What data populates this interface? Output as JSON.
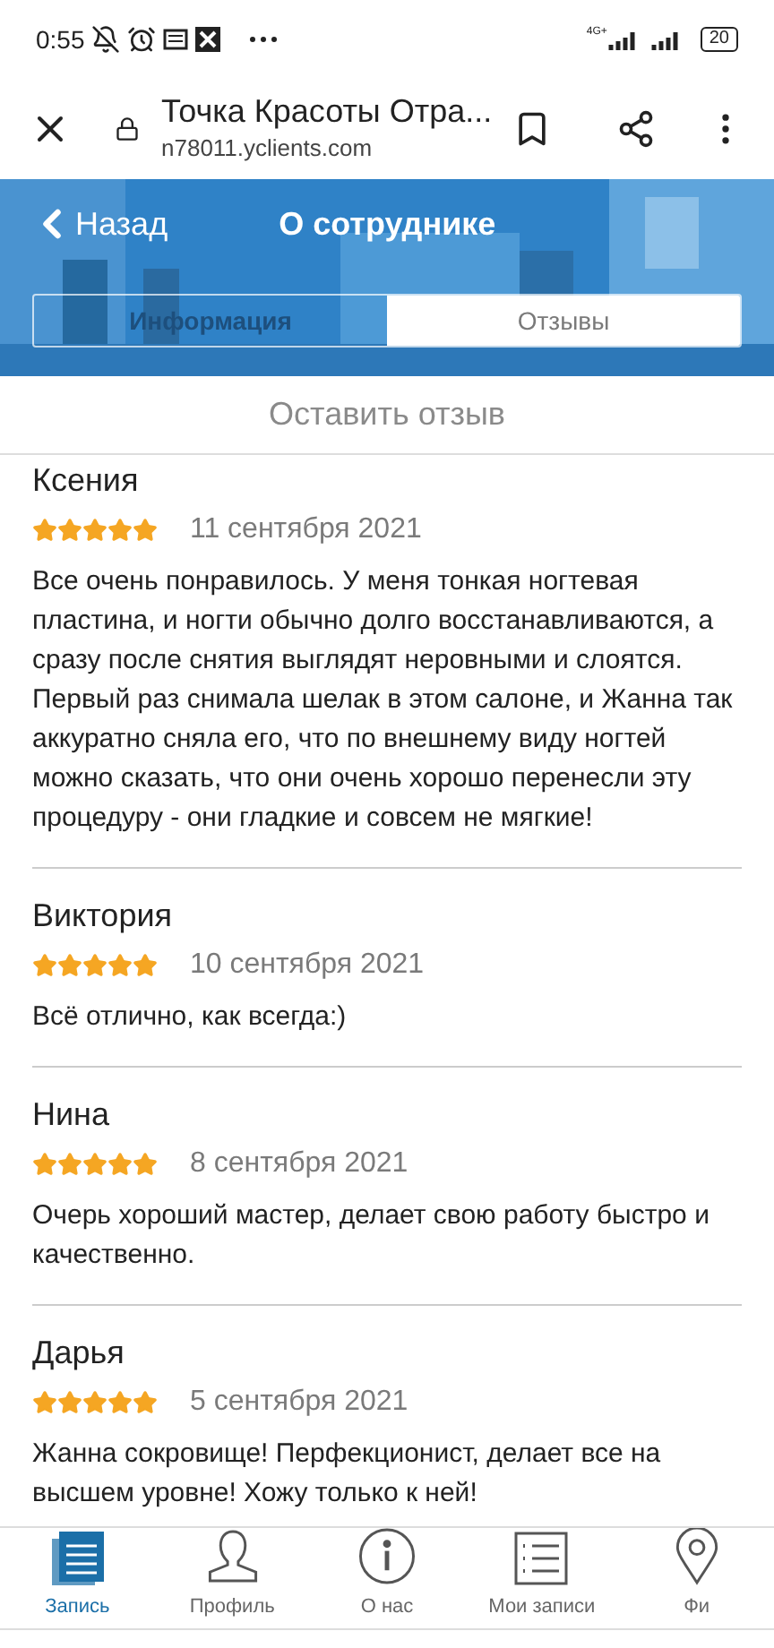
{
  "status_bar": {
    "time": "0:55",
    "network": "4G+",
    "battery": "20"
  },
  "browser": {
    "title": "Точка Красоты Отра...",
    "url": "n78011.yclients.com"
  },
  "header": {
    "back": "Назад",
    "title": "О сотруднике"
  },
  "tabs": [
    {
      "label": "Информация",
      "selected": false
    },
    {
      "label": "Отзывы",
      "selected": true
    }
  ],
  "leave_review": "Оставить отзыв",
  "reviews": [
    {
      "name": "Ксения",
      "stars": 5,
      "date": "11 сентября 2021",
      "text": "Все очень понравилось. У меня тонкая ногтевая пластина, и ногти обычно долго восстанавливаются, а сразу после снятия выглядят неровными и слоятся. Первый раз снимала шелак в этом салоне, и Жанна так аккуратно сняла его, что по внешнему виду ногтей можно сказать, что они очень хорошо перенесли эту процедуру - они гладкие и совсем не мягкие!"
    },
    {
      "name": "Виктория",
      "stars": 5,
      "date": "10 сентября 2021",
      "text": "Всё отлично, как всегда:)"
    },
    {
      "name": "Нина",
      "stars": 5,
      "date": "8 сентября 2021",
      "text": "Очерь хороший мастер, делает свою работу быстро и качественно."
    },
    {
      "name": "Дарья",
      "stars": 5,
      "date": "5 сентября 2021",
      "text": "Жанна сокровище! Перфекционист, делает все на высшем уровне! Хожу только к ней!"
    }
  ],
  "bottom_nav": [
    {
      "kind": "book",
      "label": "Запись",
      "selected": true
    },
    {
      "kind": "profile",
      "label": "Профиль",
      "selected": false
    },
    {
      "kind": "info",
      "label": "О нас",
      "selected": false
    },
    {
      "kind": "list",
      "label": "Мои записи",
      "selected": false
    },
    {
      "kind": "pin",
      "label": "Фи",
      "selected": false
    }
  ]
}
